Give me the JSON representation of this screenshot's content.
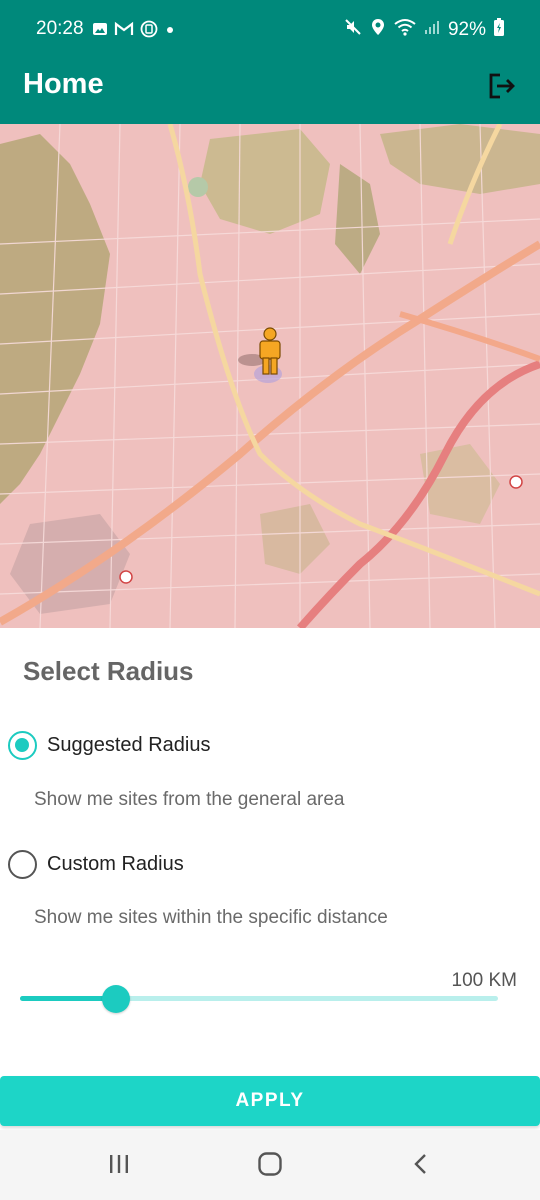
{
  "status": {
    "time": "20:28",
    "battery": "92%",
    "left_icons": [
      "image-icon",
      "gmail-icon",
      "nfc-icon",
      "dot-icon"
    ],
    "right_icons": [
      "mute-icon",
      "location-icon",
      "wifi-icon",
      "signal-icon",
      "battery-icon"
    ]
  },
  "header": {
    "title": "Home",
    "action_icon": "logout-icon"
  },
  "map": {
    "marker": "street-view-person-icon"
  },
  "radius": {
    "title": "Select Radius",
    "options": [
      {
        "label": "Suggested Radius",
        "description": "Show me sites from the general area",
        "selected": true
      },
      {
        "label": "Custom Radius",
        "description": "Show me sites within the specific distance",
        "selected": false
      }
    ],
    "slider_value_label": "100 KM",
    "slider_fraction": 0.2
  },
  "apply_label": "APPLY",
  "nav": {
    "items": [
      "recents-icon",
      "home-icon",
      "back-icon"
    ]
  },
  "colors": {
    "primary": "#00897b",
    "accent": "#1ccbc0",
    "button": "#1dd5c7",
    "map_land": "#efc0be",
    "map_green": "#b8a77a"
  }
}
